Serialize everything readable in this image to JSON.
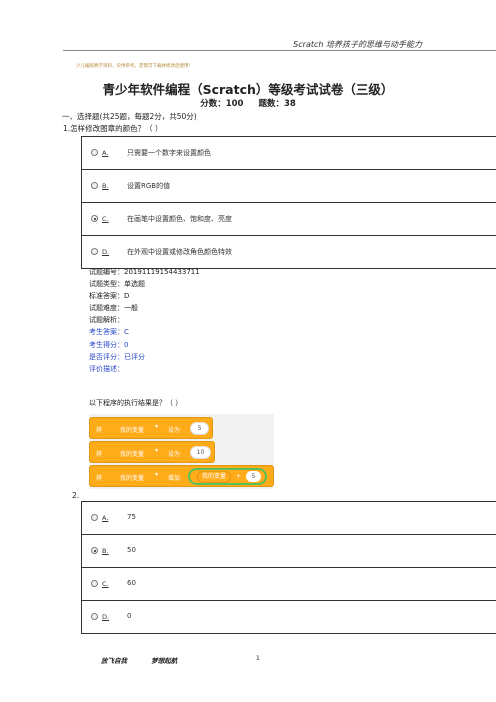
{
  "header": {
    "right_title": "Scratch  培养孩子的思维与动手能力",
    "note": "少儿编程教学资料，仅供参考，若需可下载并修改后使用！"
  },
  "title": "青少年软件编程（Scratch）等级考试试卷（三级）",
  "subtitle": {
    "score": "分数：100",
    "count": "题数：38"
  },
  "section": "一、选择题(共25题，每题2分，共50分)",
  "q1": {
    "stem": "1.怎样修改图章的颜色？（  ）",
    "options": [
      {
        "letter": "A.",
        "text": "只需要一个数字来设置颜色",
        "checked": false
      },
      {
        "letter": "B.",
        "text": "设置RGB的值",
        "checked": false
      },
      {
        "letter": "C.",
        "text": "在画笔中设置颜色、饱和度、亮度",
        "checked": true
      },
      {
        "letter": "D.",
        "text": "在外观中设置或修改角色颜色特效",
        "checked": false
      }
    ],
    "info": {
      "id": "试题编号：20191119154433711",
      "type": "试题类型：单选题",
      "answer": "标准答案：D",
      "difficulty": "试题难度：一般",
      "analysis": "试题解析：",
      "student_answer": "考生答案：C",
      "student_score": "考生得分：0",
      "graded": "是否评分：已评分",
      "comment": "评价描述："
    }
  },
  "q2": {
    "stem": "以下程序的执行结果是？（  ）",
    "number": "2.",
    "blocks": [
      {
        "verb": "将",
        "var": "我的变量",
        "op": "设为",
        "value": "5"
      },
      {
        "verb": "将",
        "var": "我的变量",
        "op": "设为",
        "value": "10"
      },
      {
        "verb": "将",
        "var": "我的变量",
        "op": "增加",
        "inner_var": "我的变量",
        "plus": "+",
        "value": "5"
      }
    ],
    "options": [
      {
        "letter": "A.",
        "text": "75",
        "checked": false
      },
      {
        "letter": "B.",
        "text": "50",
        "checked": true
      },
      {
        "letter": "C.",
        "text": "60",
        "checked": false
      },
      {
        "letter": "D.",
        "text": "0",
        "checked": false
      }
    ]
  },
  "footer": {
    "left": "放飞自我",
    "middle": "梦想起航",
    "page": "1"
  }
}
